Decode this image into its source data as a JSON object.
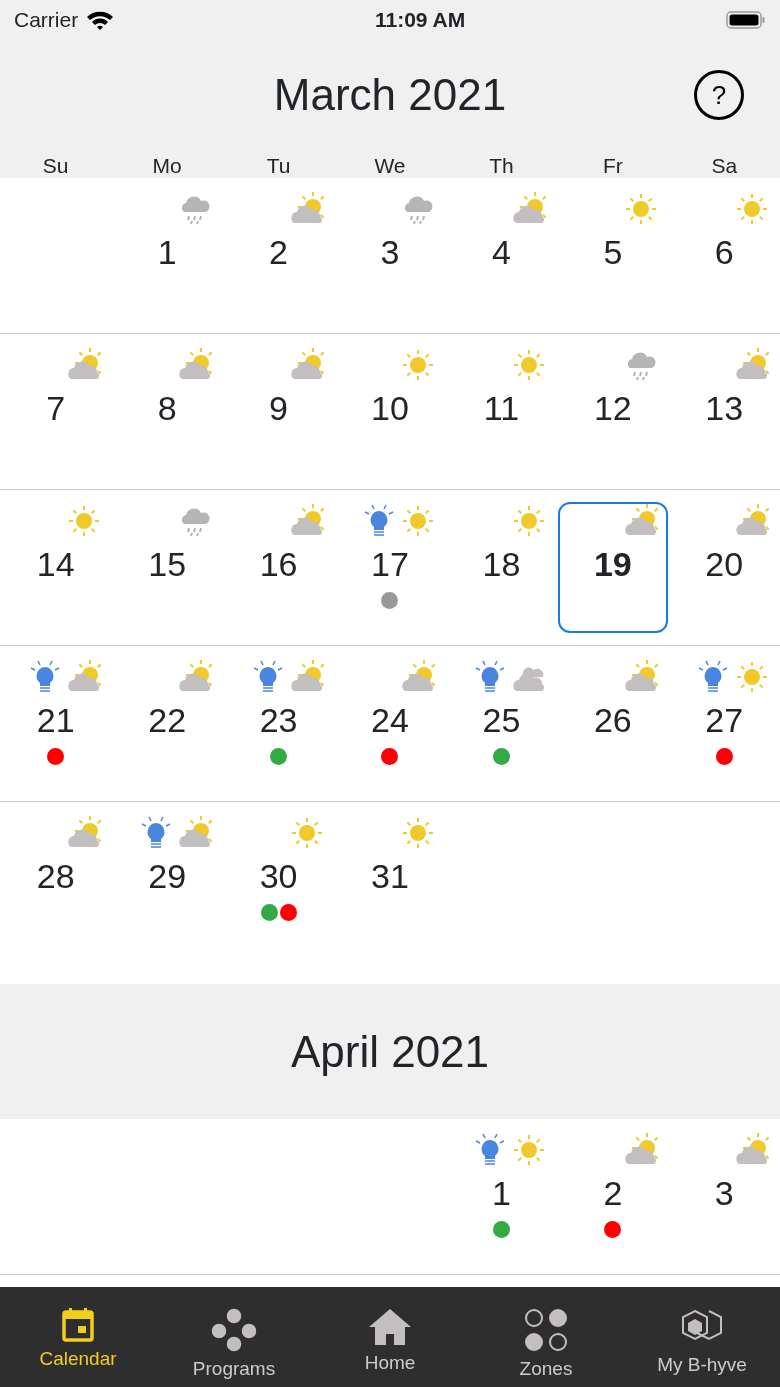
{
  "status_bar": {
    "carrier": "Carrier",
    "time": "11:09 AM"
  },
  "weekdays": [
    "Su",
    "Mo",
    "Tu",
    "We",
    "Th",
    "Fr",
    "Sa"
  ],
  "months": [
    {
      "title": "March 2021",
      "help": "?",
      "weeks": [
        [
          {
            "kind": "empty"
          },
          {
            "kind": "day",
            "day": "1",
            "weather": {
              "kind": "rain"
            },
            "bulb": false,
            "selected": false
          },
          {
            "kind": "day",
            "day": "2",
            "weather": {
              "kind": "partly"
            },
            "bulb": false,
            "selected": false
          },
          {
            "kind": "day",
            "day": "3",
            "weather": {
              "kind": "rain"
            },
            "bulb": false,
            "selected": false
          },
          {
            "kind": "day",
            "day": "4",
            "weather": {
              "kind": "partly"
            },
            "bulb": false,
            "selected": false
          },
          {
            "kind": "day",
            "day": "5",
            "weather": {
              "kind": "sun"
            },
            "bulb": false,
            "selected": false
          },
          {
            "kind": "day",
            "day": "6",
            "weather": {
              "kind": "sun"
            },
            "bulb": false,
            "selected": false
          }
        ],
        [
          {
            "kind": "day",
            "day": "7",
            "weather": {
              "kind": "partly"
            },
            "bulb": false,
            "selected": false
          },
          {
            "kind": "day",
            "day": "8",
            "weather": {
              "kind": "partly"
            },
            "bulb": false,
            "selected": false
          },
          {
            "kind": "day",
            "day": "9",
            "weather": {
              "kind": "partly"
            },
            "bulb": false,
            "selected": false
          },
          {
            "kind": "day",
            "day": "10",
            "weather": {
              "kind": "sun"
            },
            "bulb": false,
            "selected": false
          },
          {
            "kind": "day",
            "day": "11",
            "weather": {
              "kind": "sun"
            },
            "bulb": false,
            "selected": false
          },
          {
            "kind": "day",
            "day": "12",
            "weather": {
              "kind": "rain"
            },
            "bulb": false,
            "selected": false
          },
          {
            "kind": "day",
            "day": "13",
            "weather": {
              "kind": "partly"
            },
            "bulb": false,
            "selected": false
          }
        ],
        [
          {
            "kind": "day",
            "day": "14",
            "weather": {
              "kind": "sun"
            },
            "bulb": false,
            "selected": false
          },
          {
            "kind": "day",
            "day": "15",
            "weather": {
              "kind": "rain"
            },
            "bulb": false,
            "selected": false
          },
          {
            "kind": "day",
            "day": "16",
            "weather": {
              "kind": "partly"
            },
            "bulb": false,
            "selected": false
          },
          {
            "kind": "day",
            "day": "17",
            "weather": {
              "kind": "sun"
            },
            "bulb": true,
            "selected": false,
            "dots": [
              {
                "color": "#999999"
              }
            ]
          },
          {
            "kind": "day",
            "day": "18",
            "weather": {
              "kind": "sun"
            },
            "bulb": false,
            "selected": false
          },
          {
            "kind": "day",
            "day": "19",
            "weather": {
              "kind": "partly"
            },
            "bulb": false,
            "selected": true
          },
          {
            "kind": "day",
            "day": "20",
            "weather": {
              "kind": "partly"
            },
            "bulb": false,
            "selected": false
          }
        ],
        [
          {
            "kind": "day",
            "day": "21",
            "weather": {
              "kind": "partly"
            },
            "bulb": true,
            "selected": false,
            "dots": [
              {
                "color": "#ff0000"
              }
            ]
          },
          {
            "kind": "day",
            "day": "22",
            "weather": {
              "kind": "partly"
            },
            "bulb": false,
            "selected": false
          },
          {
            "kind": "day",
            "day": "23",
            "weather": {
              "kind": "partly"
            },
            "bulb": true,
            "selected": false,
            "dots": [
              {
                "color": "#33aa44"
              }
            ]
          },
          {
            "kind": "day",
            "day": "24",
            "weather": {
              "kind": "partly"
            },
            "bulb": false,
            "selected": false,
            "dots": [
              {
                "color": "#ff0000"
              }
            ]
          },
          {
            "kind": "day",
            "day": "25",
            "weather": {
              "kind": "cloudy"
            },
            "bulb": true,
            "selected": false,
            "dots": [
              {
                "color": "#33aa44"
              }
            ]
          },
          {
            "kind": "day",
            "day": "26",
            "weather": {
              "kind": "partly"
            },
            "bulb": false,
            "selected": false
          },
          {
            "kind": "day",
            "day": "27",
            "weather": {
              "kind": "sun"
            },
            "bulb": true,
            "selected": false,
            "dots": [
              {
                "color": "#ff0000"
              }
            ]
          }
        ],
        [
          {
            "kind": "day",
            "day": "28",
            "weather": {
              "kind": "partly"
            },
            "bulb": false,
            "selected": false
          },
          {
            "kind": "day",
            "day": "29",
            "weather": {
              "kind": "partly"
            },
            "bulb": true,
            "selected": false
          },
          {
            "kind": "day",
            "day": "30",
            "weather": {
              "kind": "sun"
            },
            "bulb": false,
            "selected": false,
            "dots": [
              {
                "color": "#33aa44"
              },
              {
                "color": "#ff0000"
              }
            ]
          },
          {
            "kind": "day",
            "day": "31",
            "weather": {
              "kind": "sun"
            },
            "bulb": false,
            "selected": false
          },
          {
            "kind": "empty"
          },
          {
            "kind": "empty"
          },
          {
            "kind": "empty"
          }
        ]
      ]
    },
    {
      "title": "April 2021",
      "weeks": [
        [
          {
            "kind": "empty"
          },
          {
            "kind": "empty"
          },
          {
            "kind": "empty"
          },
          {
            "kind": "empty"
          },
          {
            "kind": "day",
            "day": "1",
            "weather": {
              "kind": "sun"
            },
            "bulb": true,
            "selected": false,
            "dots": [
              {
                "color": "#33aa44"
              }
            ]
          },
          {
            "kind": "day",
            "day": "2",
            "weather": {
              "kind": "partly"
            },
            "bulb": false,
            "selected": false,
            "dots": [
              {
                "color": "#ff0000"
              }
            ]
          },
          {
            "kind": "day",
            "day": "3",
            "weather": {
              "kind": "partly"
            },
            "bulb": false,
            "selected": false
          }
        ]
      ]
    }
  ],
  "tabs": [
    {
      "label": "Calendar",
      "selected": true
    },
    {
      "label": "Programs",
      "selected": false
    },
    {
      "label": "Home",
      "selected": false
    },
    {
      "label": "Zones",
      "selected": false
    },
    {
      "label": "My B-hyve",
      "selected": false
    }
  ]
}
